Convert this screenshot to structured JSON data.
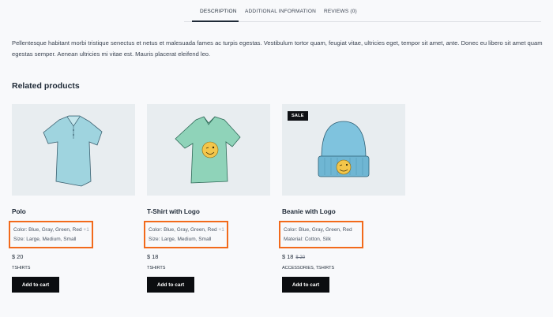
{
  "tabs": [
    {
      "label": "Description",
      "active": true
    },
    {
      "label": "Additional information",
      "active": false
    },
    {
      "label": "Reviews (0)",
      "active": false
    }
  ],
  "description": "Pellentesque habitant morbi tristique senectus et netus et malesuada fames ac turpis egestas. Vestibulum tortor quam, feugiat vitae, ultricies eget, tempor sit amet, ante. Donec eu libero sit amet quam egestas semper. Aenean ultricies mi vitae est. Mauris placerat eleifend leo.",
  "related": {
    "title": "Related products",
    "products": [
      {
        "name": "Polo",
        "image_icon": "polo-shirt-icon",
        "badge": "",
        "attr1": "Color: Blue, Gray, Green, Red",
        "attr1_more": "+1",
        "attr2": "Size: Large, Medium, Small",
        "price": "$ 20",
        "old_price": "",
        "categories": "TSHIRTS",
        "button": "Add to cart"
      },
      {
        "name": "T-Shirt with Logo",
        "image_icon": "tshirt-logo-icon",
        "badge": "",
        "attr1": "Color: Blue, Gray, Green, Red",
        "attr1_more": "+1",
        "attr2": "Size: Large, Medium, Small",
        "price": "$ 18",
        "old_price": "",
        "categories": "TSHIRTS",
        "button": "Add to cart"
      },
      {
        "name": "Beanie with Logo",
        "image_icon": "beanie-logo-icon",
        "badge": "SALE",
        "attr1": "Color: Blue, Gray, Green, Red",
        "attr1_more": "",
        "attr2": "Material: Cotton, Silk",
        "price": "$ 18",
        "old_price": "$ 20",
        "categories": "ACCESSORIES, TSHIRTS",
        "button": "Add to cart"
      }
    ]
  },
  "colors": {
    "highlight": "#f26a1b",
    "button_bg": "#0b0d10",
    "image_bg": "#e8edf0"
  }
}
